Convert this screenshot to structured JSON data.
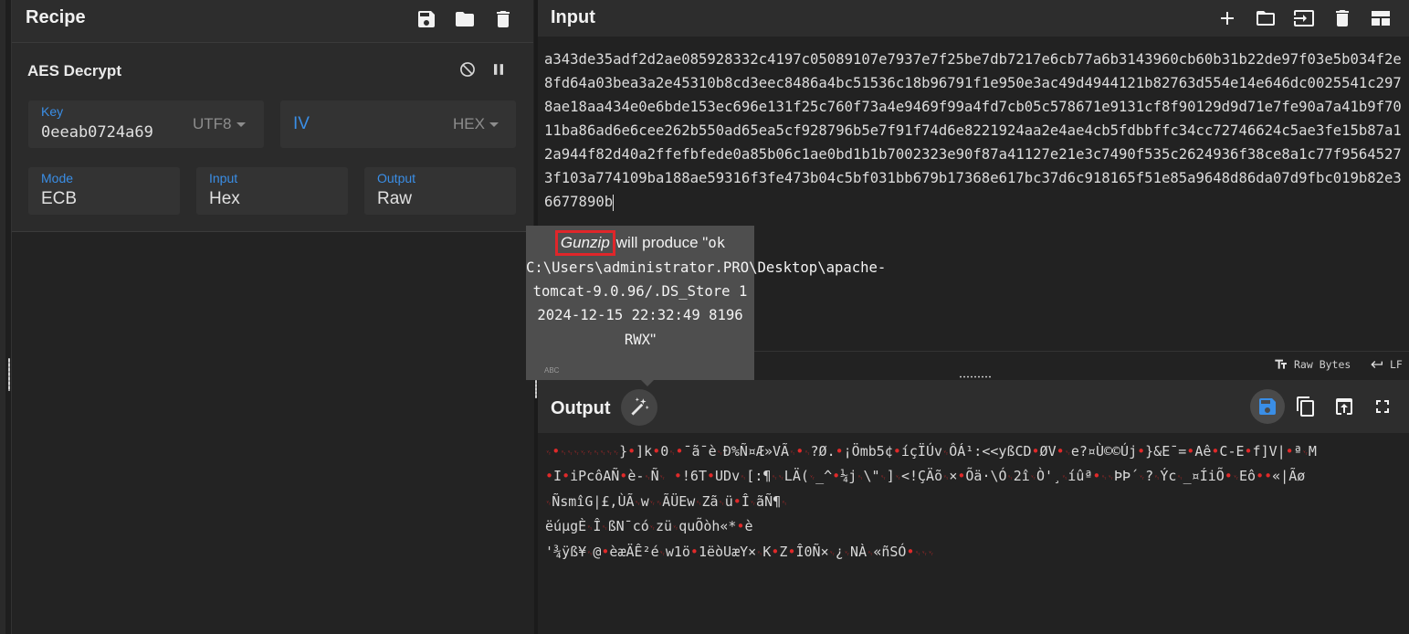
{
  "recipe": {
    "title": "Recipe",
    "header_icons": [
      "save-icon",
      "folder-icon",
      "trash-icon"
    ],
    "operation": {
      "name": "AES Decrypt",
      "controls": [
        "disable-icon",
        "pause-icon"
      ],
      "key": {
        "label": "Key",
        "value": "0eeab0724a69",
        "encoding": "UTF8"
      },
      "iv": {
        "label": "IV",
        "value": "",
        "encoding": "HEX"
      },
      "mode": {
        "label": "Mode",
        "value": "ECB"
      },
      "input": {
        "label": "Input",
        "value": "Hex"
      },
      "output": {
        "label": "Output",
        "value": "Raw"
      }
    }
  },
  "input": {
    "title": "Input",
    "header_icons": [
      "add-icon",
      "folder-icon",
      "import-icon",
      "trash-icon",
      "layout-icon"
    ],
    "text": "a343de35adf2d2ae085928332c4197c05089107e7937e7f25be7db7217e6cb77a6b3143960cb60b31b22de97f03e5b034f2e8fd64a03bea3a2e45310b8cd3eec8486a4bc51536c18b96791f1e950e3ac49d4944121b82763d554e14e646dc0025541c2978ae18aa434e0e6bde153ec696e131f25c760f73a4e9469f99a4fd7cb05c578671e9131cf8f90129d9d71e7fe90a7a41b9f7011ba86ad6e6cee262b550ad65ea5cf928796b5e7f91f74d6e8221924aa2e4ae4cb5fdbbffc34cc72746624c5ae3fe15b87a12a944f82d40a2ffefbfede0a85b06c1ae0bd1b1b7002323e90f87a41127e21e3c7490f535c2624936f38ce8a1c77f95645273f103a774109ba188ae59316f3fe473b04c5bf031bb679b17368e617bc37d6c918165f51e85a9648d86da07d9fbc019b82e36677890b",
    "status_raw_bytes": "Raw Bytes",
    "status_eol": "LF"
  },
  "output": {
    "title": "Output",
    "header_icons": [
      "save-icon",
      "copy-icon",
      "replace-input-icon",
      "maximize-icon"
    ],
    "text": "␋•␋␋␋␋␋␋␋␋␋}•]k•0␋•¯ã¯è␋Ð%Ñ¤Æ»VÃ␋•␋?Ø.•¡Ömb5¢•íçÏÚv␋ÔÁ¹:<<yßCD•ØV•␋e?¤Ù©©Új•}&E¯=•Aê•C-E•f]V|•ª␋M\n•I•iPcôAÑ•è-␋Ñ␋ •!6T•UDv␋[:¶␋␋LÄ(␋_^•¼j␋\\\"␋]␋<!ÇÄõ␋×•Õä·\\Ó␋2î␋Ò'¸␋íûª•␋␋ÞÞ´␋?␋Ýc␋_¤ÍiÕ•␋Eô••«|Ãø\n␋ÑsmîG|£,ÙÃ␋w␋␋ÃÜEw␋Zã␋ü•Î␋ãÑ¶␋\nëúµgÈ␋Î␋ßN¯có␋zü␋quÕòh«*•è\n'¾ÿß¥␋@•èæÄÊ²é␋w1ö•1ëòUæY×␋K•Z•Î0Ñ×␋¿␋NÀ␋«ñSÓ•␋␋␋"
  },
  "tooltip": {
    "operation": "Gunzip",
    "text_prefix": "will produce \"",
    "result": "ok C:\\Users\\administrator.PRO\\Desktop\\apache-tomcat-9.0.96/.DS_Store 1 2024-12-15 22:32:49 8196 RWX",
    "text_suffix": "\"",
    "badge": "ABC"
  },
  "colors": {
    "accent": "#3a8ee6",
    "highlight": "#e0262a",
    "control_char": "#e02a2a"
  }
}
